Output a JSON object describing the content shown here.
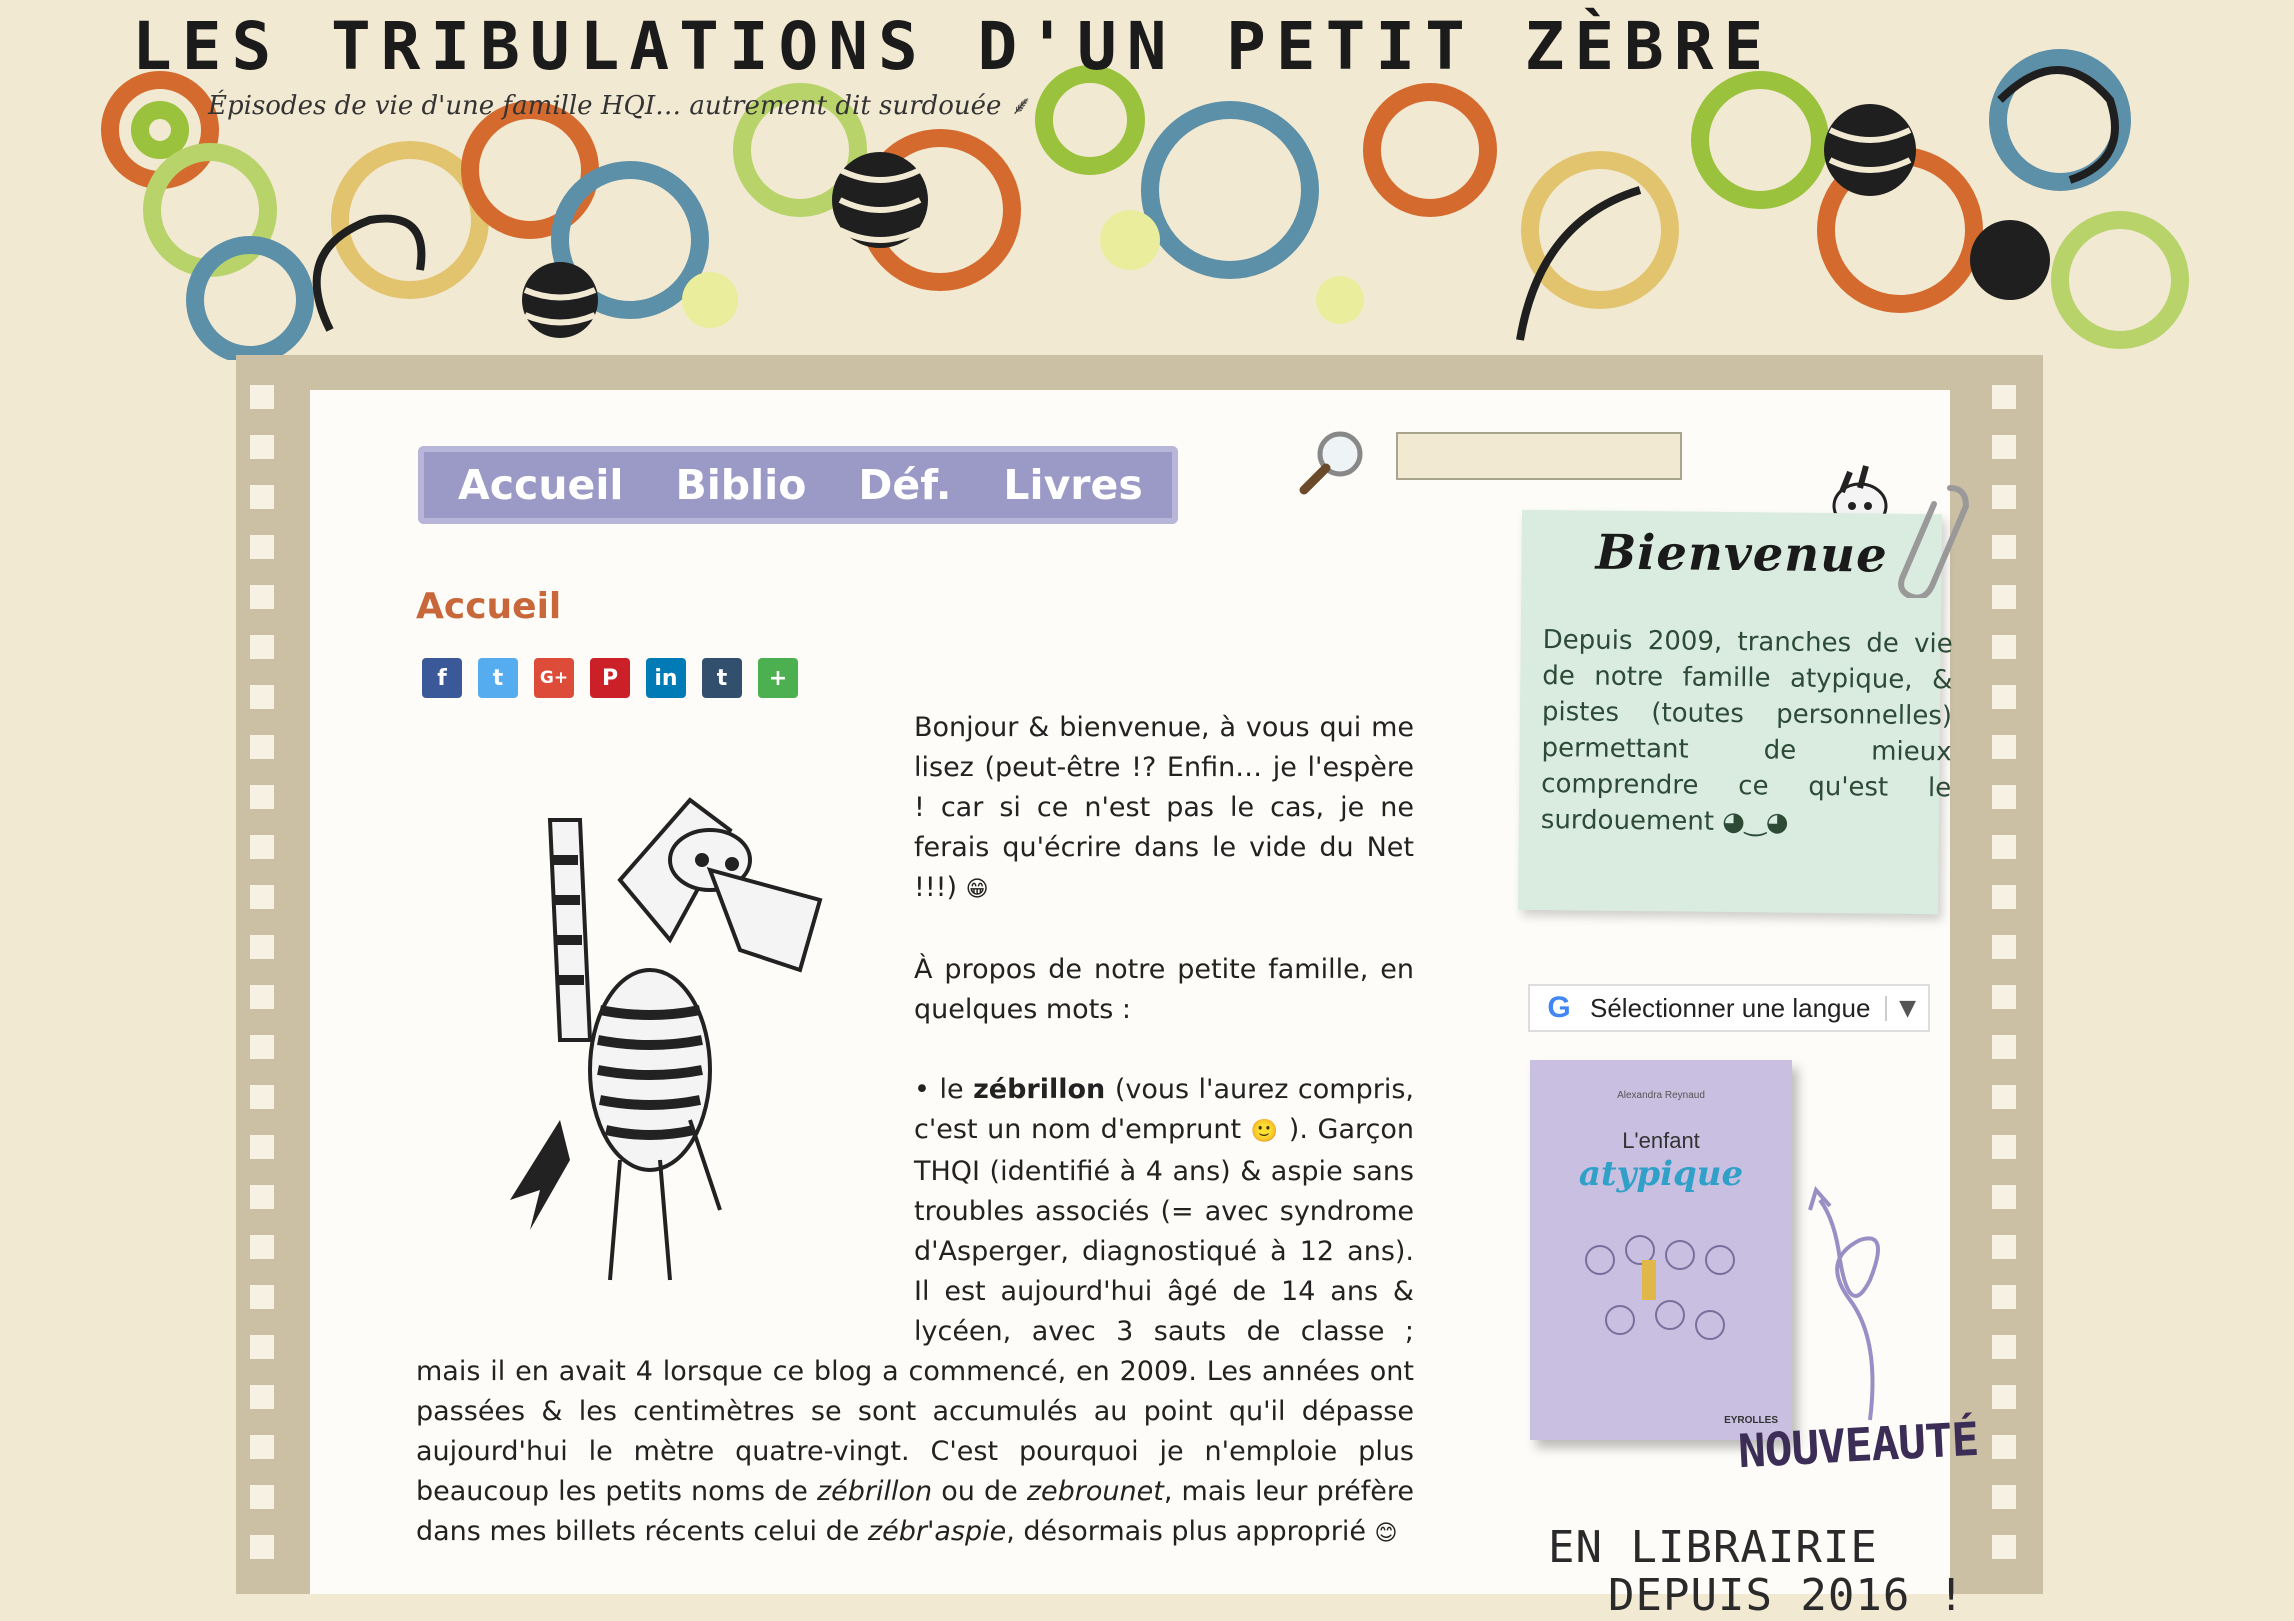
{
  "header": {
    "title": "LES TRIBULATIONS D'UN PETIT ZÈBRE",
    "subtitle": "Épisodes de vie d'une famille HQI… autrement dit surdouée ⸙"
  },
  "nav": {
    "items": [
      {
        "label": "Accueil"
      },
      {
        "label": "Biblio"
      },
      {
        "label": "Déf."
      },
      {
        "label": "Livres"
      }
    ]
  },
  "search": {
    "placeholder": ""
  },
  "page": {
    "title": "Accueil"
  },
  "share": {
    "buttons": [
      {
        "icon": "facebook-icon",
        "glyph": "f",
        "color": "#3b5998"
      },
      {
        "icon": "twitter-icon",
        "glyph": "t",
        "color": "#55acee"
      },
      {
        "icon": "google-plus-icon",
        "glyph": "G+",
        "color": "#dd4b39"
      },
      {
        "icon": "pinterest-icon",
        "glyph": "P",
        "color": "#cb2027"
      },
      {
        "icon": "linkedin-icon",
        "glyph": "in",
        "color": "#007bb5"
      },
      {
        "icon": "tumblr-icon",
        "glyph": "t",
        "color": "#32506d"
      },
      {
        "icon": "more-icon",
        "glyph": "+",
        "color": "#4caf50"
      }
    ]
  },
  "article": {
    "p1": "Bonjour & bienvenue, à vous qui me lisez (peut-être !? Enfin… je l'espère ! car si ce n'est pas le cas, je ne ferais qu'écrire dans le vide du Net !!!)",
    "p1_emoji": "😁",
    "p2": "À propos de notre petite famille, en quelques mots :",
    "p3_bullet": "• le ",
    "p3_bold": "zébrillon",
    "p3_a": " (vous l'aurez compris, c'est un nom d'emprunt ",
    "p3_emoji": "🙂",
    "p3_b": " ). Garçon THQI (identifié à 4 ans) & aspie sans troubles associés (= avec syndrome d'Asperger, diagnostiqué à 12 ans). Il est aujourd'hui âgé de 14 ans & lycéen, avec 3 sauts de classe ; mais il en avait 4 lorsque ce blog a commencé, en 2009. Les années ont passées & les centimètres se sont accumulés au point qu'il dépasse aujourd'hui le mètre quatre-vingt. C'est pourquoi je n'emploie plus beaucoup les petits noms de ",
    "p3_it1": "zébrillon",
    "p3_c": " ou de ",
    "p3_it2": "zebrounet",
    "p3_d": ", mais leur préfère dans mes billets récents celui de ",
    "p3_it3": "zébr'aspie",
    "p3_e": ", désormais plus approprié ",
    "p3_emoji2": "😊"
  },
  "sidebar": {
    "welcome_title": "Bienvenue",
    "welcome_text": "Depuis 2009, tranches de vie de notre famille atypique, & pistes (toutes personnelles) permettant de mieux comprendre ce qu'est le surdouement ◕‿◕",
    "language_select": "Sélectionner une langue",
    "google_glyph": "G",
    "book": {
      "author": "Alexandra Reynaud",
      "title_line1": "L'enfant",
      "title_line2": "atypique",
      "publisher": "EYROLLES"
    },
    "nouveaute": "NOUVEAUTÉ",
    "en_librairie": "EN LIBRAIRIE",
    "depuis": "DEPUIS 2016 !"
  },
  "colors": {
    "nav_bg": "#9b99c6",
    "title_orange": "#c8673a",
    "note_green": "#d9ecdf",
    "frame_beige": "#cbbfa4"
  }
}
